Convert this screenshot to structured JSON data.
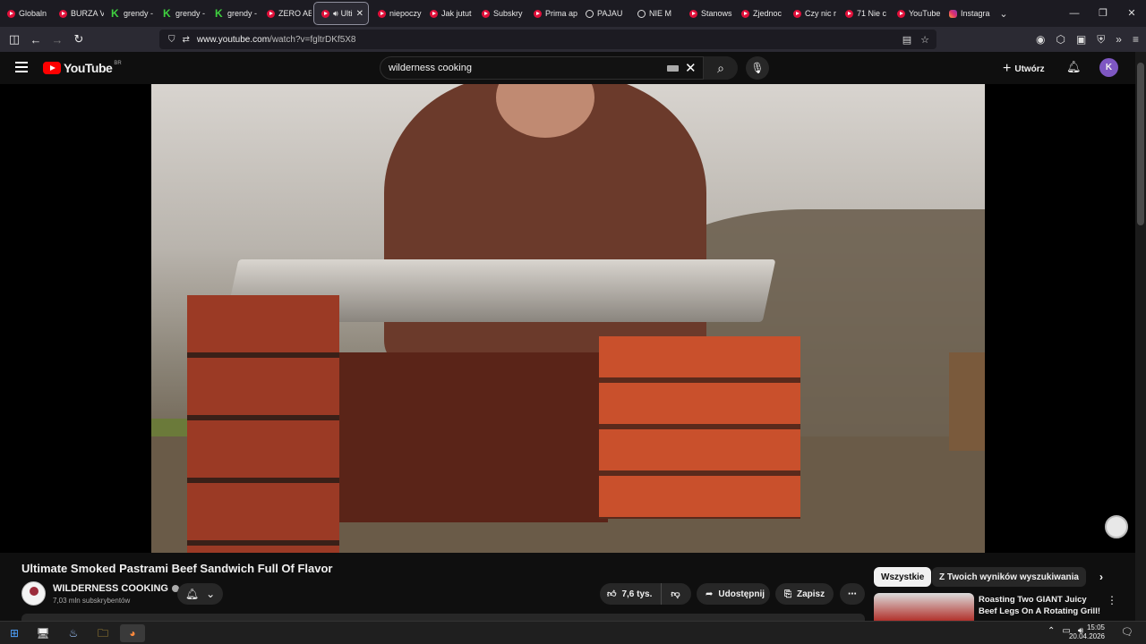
{
  "browser": {
    "tabs": [
      {
        "label": "Globaln",
        "icon": "youtube"
      },
      {
        "label": "BURZA V",
        "icon": "youtube"
      },
      {
        "label": "grendy -",
        "icon": "k"
      },
      {
        "label": "grendy -",
        "icon": "k"
      },
      {
        "label": "grendy -",
        "icon": "k"
      },
      {
        "label": "ZERO AB",
        "icon": "youtube"
      },
      {
        "label": "Ulti",
        "icon": "youtube",
        "active": true
      },
      {
        "label": "niepoczy",
        "icon": "youtube"
      },
      {
        "label": "Jak jutut",
        "icon": "youtube"
      },
      {
        "label": "Subskry",
        "icon": "youtube"
      },
      {
        "label": "Prima ap",
        "icon": "youtube"
      },
      {
        "label": "PAJAU",
        "icon": "circle"
      },
      {
        "label": "NIE M",
        "icon": "circle"
      },
      {
        "label": "Stanows",
        "icon": "youtube"
      },
      {
        "label": "Zjednoc",
        "icon": "youtube"
      },
      {
        "label": "Czy nic r",
        "icon": "youtube"
      },
      {
        "label": "71 Nie c",
        "icon": "youtube"
      },
      {
        "label": "YouTube",
        "icon": "youtube"
      },
      {
        "label": "Instagra",
        "icon": "instagram"
      }
    ],
    "url": {
      "host": "www.youtube.com",
      "path": "/watch?v=fgltrDKf5X8"
    }
  },
  "youtube": {
    "country_code": "BR",
    "search_value": "wilderness cooking",
    "create_label": "Utwórz",
    "avatar_letter": "K"
  },
  "video": {
    "title": "Ultimate Smoked Pastrami Beef Sandwich Full Of Flavor",
    "channel_name": "WILDERNESS COOKING",
    "subscribers": "7,03 mln subskrybentów",
    "likes": "7,6 tys.",
    "share_label": "Udostępnij",
    "save_label": "Zapisz"
  },
  "sidebar": {
    "chips": [
      "Wszystkie",
      "Z Twoich wyników wyszukiwania"
    ],
    "next_video_title": "Roasting Two GIANT Juicy Beef Legs On A Rotating Grill!"
  },
  "taskbar": {
    "time": "15:05",
    "date": "20.04.2026"
  },
  "colors": {
    "accent": "#ff0000",
    "avatar_bg": "#7e57c2",
    "background": "#0f0f0f"
  }
}
